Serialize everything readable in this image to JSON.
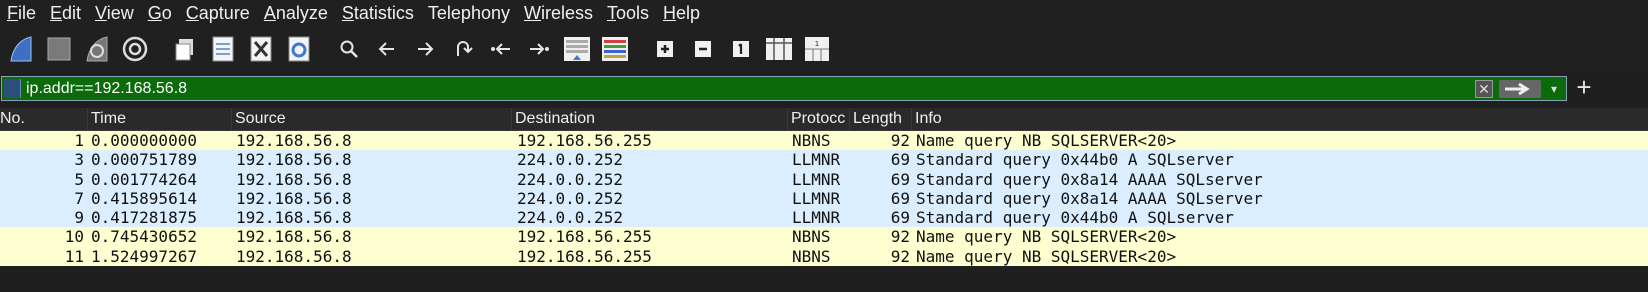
{
  "menu": [
    {
      "ul": "F",
      "rest": "ile"
    },
    {
      "ul": "E",
      "rest": "dit"
    },
    {
      "ul": "V",
      "rest": "iew"
    },
    {
      "ul": "G",
      "rest": "o"
    },
    {
      "ul": "C",
      "rest": "apture"
    },
    {
      "ul": "A",
      "rest": "nalyze"
    },
    {
      "ul": "S",
      "rest": "tatistics"
    },
    {
      "ul": "",
      "rest": "Telephony"
    },
    {
      "ul": "W",
      "rest": "ireless"
    },
    {
      "ul": "T",
      "rest": "ools"
    },
    {
      "ul": "H",
      "rest": "elp"
    }
  ],
  "filter": {
    "value": "ip.addr==192.168.56.8",
    "color": "#0b6b0b"
  },
  "columns": [
    "No.",
    "Time",
    "Source",
    "Destination",
    "Protocol",
    "Length",
    "Info"
  ],
  "columns_shown": [
    "No.",
    "Time",
    "Source",
    "Destination",
    "Protocc",
    "Length",
    "Info"
  ],
  "colors": {
    "nbns_row": "#feffd0",
    "llmnr_row": "#daeeff"
  },
  "packets": [
    {
      "no": "1",
      "time": "0.000000000",
      "source": "192.168.56.8",
      "destination": "192.168.56.255",
      "protocol": "NBNS",
      "length": "92",
      "info": "Name query NB SQLSERVER<20>"
    },
    {
      "no": "3",
      "time": "0.000751789",
      "source": "192.168.56.8",
      "destination": "224.0.0.252",
      "protocol": "LLMNR",
      "length": "69",
      "info": "Standard query 0x44b0 A SQLserver"
    },
    {
      "no": "5",
      "time": "0.001774264",
      "source": "192.168.56.8",
      "destination": "224.0.0.252",
      "protocol": "LLMNR",
      "length": "69",
      "info": "Standard query 0x8a14 AAAA SQLserver"
    },
    {
      "no": "7",
      "time": "0.415895614",
      "source": "192.168.56.8",
      "destination": "224.0.0.252",
      "protocol": "LLMNR",
      "length": "69",
      "info": "Standard query 0x8a14 AAAA SQLserver"
    },
    {
      "no": "9",
      "time": "0.417281875",
      "source": "192.168.56.8",
      "destination": "224.0.0.252",
      "protocol": "LLMNR",
      "length": "69",
      "info": "Standard query 0x44b0 A SQLserver"
    },
    {
      "no": "10",
      "time": "0.745430652",
      "source": "192.168.56.8",
      "destination": "192.168.56.255",
      "protocol": "NBNS",
      "length": "92",
      "info": "Name query NB SQLSERVER<20>"
    },
    {
      "no": "11",
      "time": "1.524997267",
      "source": "192.168.56.8",
      "destination": "192.168.56.255",
      "protocol": "NBNS",
      "length": "92",
      "info": "Name query NB SQLSERVER<20>"
    }
  ],
  "toolbar_icons": [
    "start-capture-icon",
    "stop-capture-icon",
    "restart-capture-icon",
    "capture-options-icon",
    "open-file-icon",
    "save-file-icon",
    "close-file-icon",
    "reload-file-icon",
    "find-packet-icon",
    "go-back-icon",
    "go-forward-icon",
    "go-to-packet-icon",
    "first-packet-icon",
    "last-packet-icon",
    "autoscroll-icon",
    "colorize-icon",
    "zoom-in-icon",
    "zoom-out-icon",
    "normal-size-icon",
    "resize-columns-icon",
    "layout-icon"
  ]
}
